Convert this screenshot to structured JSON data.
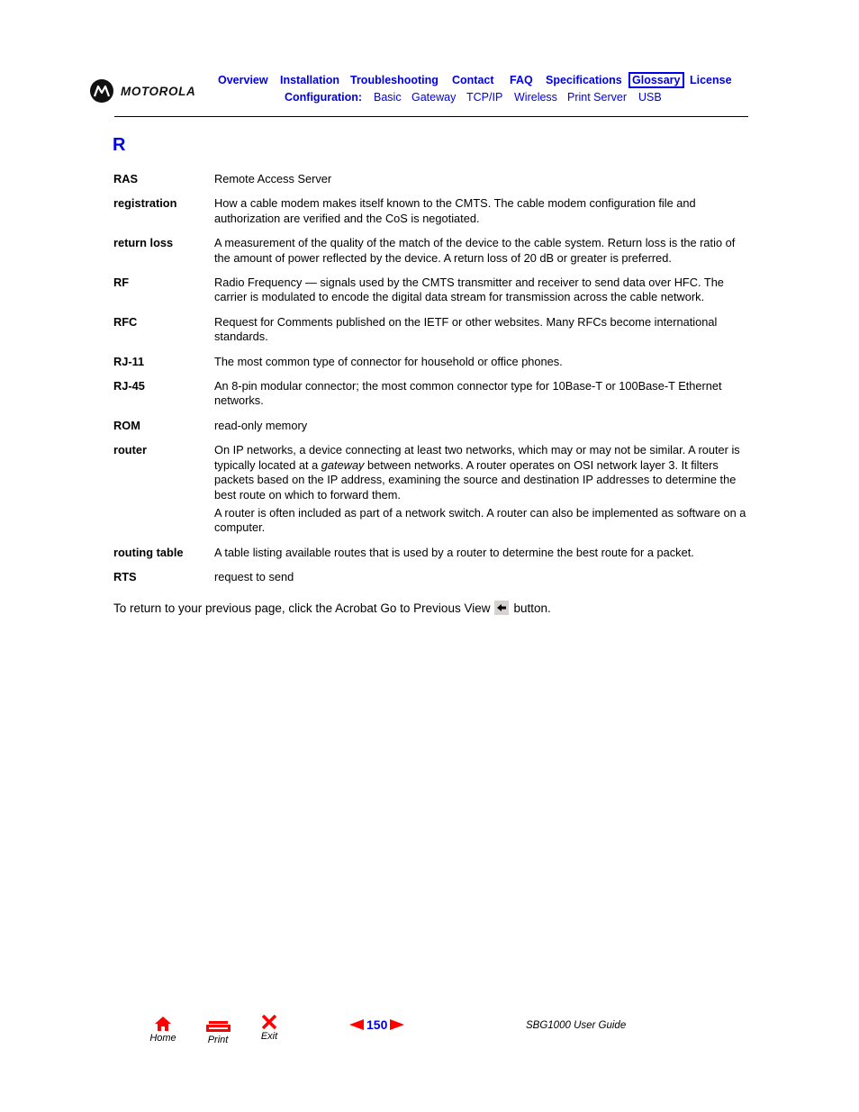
{
  "header": {
    "logo_text": "MOTOROLA",
    "nav_primary": [
      {
        "label": "Overview",
        "current": false
      },
      {
        "label": "Installation",
        "current": false
      },
      {
        "label": "Troubleshooting",
        "current": false
      },
      {
        "label": "Contact",
        "current": false
      },
      {
        "label": "FAQ",
        "current": false
      },
      {
        "label": "Specifications",
        "current": false
      },
      {
        "label": "Glossary",
        "current": true
      },
      {
        "label": "License",
        "current": false
      }
    ],
    "config_label": "Configuration:",
    "nav_config": [
      {
        "label": "Basic"
      },
      {
        "label": "Gateway"
      },
      {
        "label": "TCP/IP"
      },
      {
        "label": "Wireless"
      },
      {
        "label": "Print Server"
      },
      {
        "label": "USB"
      }
    ]
  },
  "section": {
    "letter": "R",
    "entries": [
      {
        "term": "RAS",
        "definitions": [
          "Remote Access Server"
        ]
      },
      {
        "term": "registration",
        "definitions": [
          "How a cable modem makes itself known to the CMTS. The cable modem configuration file and authorization are verified and the CoS is negotiated."
        ]
      },
      {
        "term": "return loss",
        "definitions": [
          "A measurement of the quality of the match of the device to the cable system. Return loss is the ratio of the amount of power reflected by the device. A return loss of 20 dB or greater is preferred."
        ]
      },
      {
        "term": "RF",
        "definitions": [
          "Radio Frequency — signals used by the CMTS transmitter and receiver to send data over HFC. The carrier is modulated to encode the digital data stream for transmission across the cable network."
        ]
      },
      {
        "term": "RFC",
        "definitions": [
          "Request for Comments published on the IETF or other websites. Many RFCs become international standards."
        ]
      },
      {
        "term": "RJ-11",
        "definitions": [
          "The most common type of connector for household or office phones."
        ]
      },
      {
        "term": "RJ-45",
        "definitions": [
          "An 8-pin modular connector; the most common connector type for 10Base-T or 100Base-T Ethernet networks."
        ]
      },
      {
        "term": "ROM",
        "definitions": [
          "read-only memory"
        ]
      },
      {
        "term": "router",
        "definitions": [
          {
            "before": "On IP networks, a device connecting at least two networks, which may or may not be similar. A router is typically located at a ",
            "italic": "gateway",
            "after": " between networks. A router operates on OSI network layer 3. It filters packets based on the IP address, examining the source and destination IP addresses to determine the best route on which to forward them."
          },
          "A router is often included as part of a network switch. A router can also be implemented as software on a computer."
        ]
      },
      {
        "term": "routing table",
        "definitions": [
          "A table listing available routes that is used by a router to determine the best route for a packet."
        ]
      },
      {
        "term": "RTS",
        "definitions": [
          "request to send"
        ]
      }
    ]
  },
  "note": {
    "before": "To return to your previous page, click the Acrobat Go to Previous View",
    "after": "button.",
    "icon": "back-arrow-icon"
  },
  "footer": {
    "home_label": "Home",
    "print_label": "Print",
    "exit_label": "Exit",
    "page_number": "150",
    "guide_title": "SBG1000 User Guide"
  },
  "colors": {
    "link": "#0000e6",
    "footer_icon": "#ff0000",
    "prev_view_button_bg": "#d6d3ce"
  }
}
